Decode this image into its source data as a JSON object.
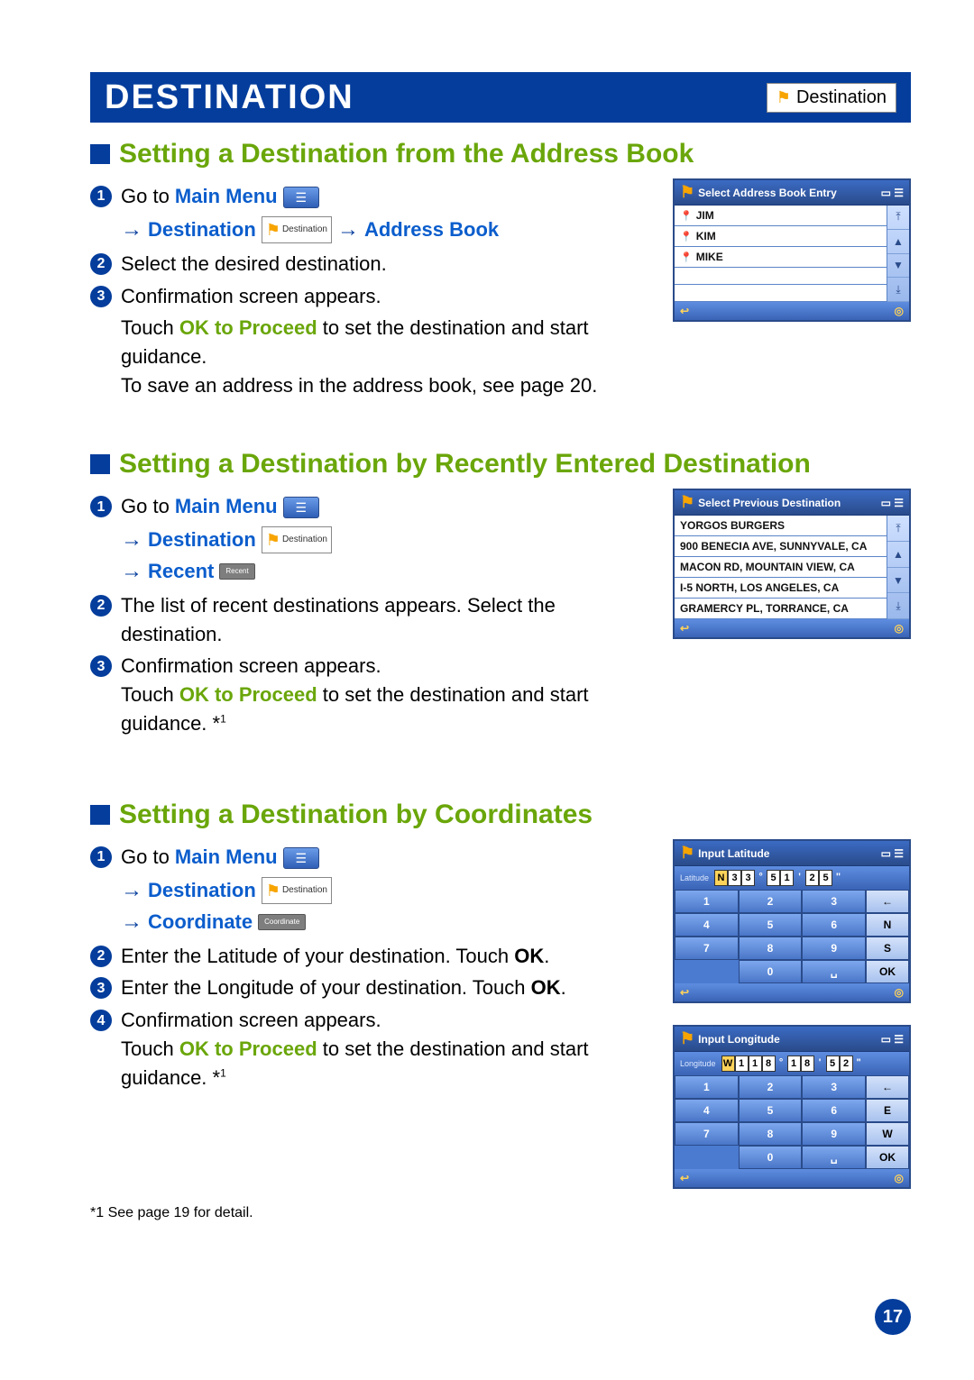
{
  "header": {
    "title": "DESTINATION",
    "badge": "Destination"
  },
  "section1": {
    "title": "Setting a Destination from the Address Book",
    "step1_prefix": "Go to ",
    "step1_link": "Main Menu",
    "nav_dest": "Destination",
    "nav_chip": "Destination",
    "nav_addr": "Address Book",
    "step2": "Select the desired destination.",
    "step3": "Confirmation screen appears.",
    "para1a": "Touch ",
    "para1b": "OK to Proceed",
    "para1c": " to set the destination and start guidance.",
    "para2": "To save an address in the address book, see page 20.",
    "ss_title": "Select Address Book Entry",
    "entries": [
      "JIM",
      "KIM",
      "MIKE"
    ]
  },
  "section2": {
    "title": "Setting a Destination by Recently Entered Destination",
    "step1_prefix": "Go to ",
    "step1_link": "Main Menu",
    "nav_dest": "Destination",
    "nav_recent": "Recent",
    "step2": "The list of recent destinations appears. Select the destination.",
    "step3a": "Confirmation screen appears.",
    "step3b_pre": "Touch ",
    "step3b_bold": "OK to Proceed",
    "step3b_post": " to set the destination and start guidance. *",
    "ss_title": "Select Previous Destination",
    "entries": [
      "YORGOS BURGERS",
      "900 BENECIA AVE, SUNNYVALE, CA",
      "MACON RD, MOUNTAIN VIEW, CA",
      "I-5 NORTH, LOS ANGELES, CA",
      "GRAMERCY PL, TORRANCE, CA"
    ]
  },
  "section3": {
    "title": "Setting a Destination by Coordinates",
    "step1_prefix": "Go to ",
    "step1_link": "Main Menu",
    "nav_dest": "Destination",
    "nav_coord": "Coordinate",
    "step2a": "Enter the Latitude of your destination. Touch ",
    "step2b": "OK",
    "step3a": "Enter the Longitude of your destination. Touch ",
    "step3b": "OK",
    "step4a": "Confirmation screen appears.",
    "step4b_pre": "Touch ",
    "step4b_bold": "OK to Proceed",
    "step4b_post": " to set the destination and start guidance. *",
    "lat_title": "Input Latitude",
    "lat_label": "Latitude",
    "lat_digits": [
      "N",
      "3",
      "3",
      "°",
      "5",
      "1",
      "'",
      "2",
      "5",
      "\""
    ],
    "lon_title": "Input Longitude",
    "lon_label": "Longitude",
    "lon_digits": [
      "W",
      "1",
      "1",
      "8",
      "°",
      "1",
      "8",
      "'",
      "5",
      "2",
      "\""
    ],
    "keys": [
      "1",
      "2",
      "3",
      "4",
      "5",
      "6",
      "7",
      "8",
      "9",
      "0",
      "␣"
    ],
    "lat_side": [
      "←",
      "N",
      "S",
      "OK"
    ],
    "lon_side": [
      "←",
      "E",
      "W",
      "OK"
    ]
  },
  "footnote": "See page 19 for detail.",
  "footnote_marker": "*1 ",
  "page": "17",
  "chart_data": null
}
